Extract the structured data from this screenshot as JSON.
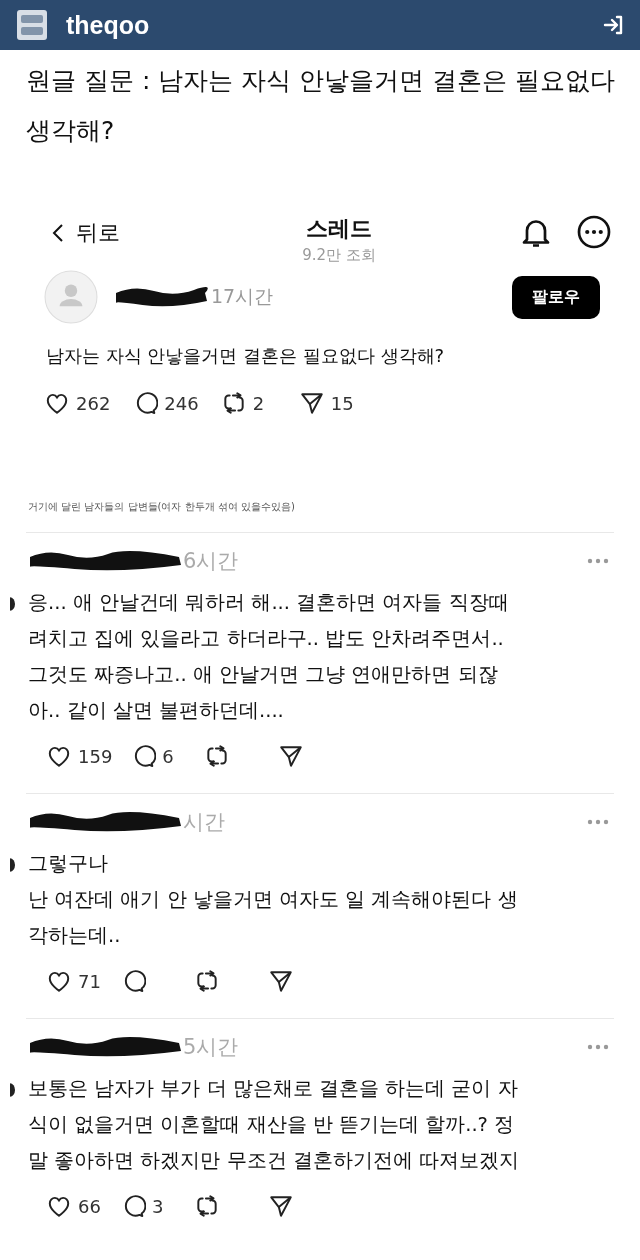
{
  "site_header": {
    "logo_text": "theqoo"
  },
  "post_title": "원글 질문 : 남자는 자식 안낳을거면 결혼은 필요없다 생각해?",
  "thread_header": {
    "back_label": "뒤로",
    "title": "스레드",
    "views": "9.2만 조회"
  },
  "original_post": {
    "time": "17시간",
    "follow_button": "팔로우",
    "text": "남자는 자식 안낳을거면 결혼은 필요없다 생각해?",
    "actions": [
      {
        "kind": "like",
        "count": "262"
      },
      {
        "kind": "reply",
        "count": "246"
      },
      {
        "kind": "repost",
        "count": "2"
      },
      {
        "kind": "share",
        "count": "15"
      }
    ]
  },
  "note": "거기에 달린 남자들의 답변들(여자 한두개 섞여 있을수있음)",
  "replies": [
    {
      "time": "6시간",
      "lines": [
        "응... 애 안날건데 뭐하러 해... 결혼하면 여자들 직장때",
        "려치고 집에 있을라고 하더라구.. 밥도 안차려주면서..",
        "그것도 짜증나고.. 애 안날거면 그냥 연애만하면 되잖",
        "아.. 같이 살면 불편하던데...."
      ],
      "actions": [
        {
          "kind": "like",
          "count": "159"
        },
        {
          "kind": "reply",
          "count": "6"
        },
        {
          "kind": "repost"
        },
        {
          "kind": "share"
        }
      ]
    },
    {
      "time": "시간",
      "lines": [
        "그렇구나",
        "난 여잔데 애기 안 낳을거면 여자도 일 계속해야된다 생",
        "각하는데.."
      ],
      "actions": [
        {
          "kind": "like",
          "count": "71"
        },
        {
          "kind": "reply"
        },
        {
          "kind": "repost"
        },
        {
          "kind": "share"
        }
      ]
    },
    {
      "time": "5시간",
      "lines": [
        "보통은 남자가 부가 더 많은채로 결혼을 하는데 굳이 자",
        "식이 없을거면 이혼할때 재산을 반 뜯기는데 할까..? 정",
        "말 좋아하면 하겠지만 무조건 결혼하기전에 따져보겠지"
      ],
      "actions": [
        {
          "kind": "like",
          "count": "66"
        },
        {
          "kind": "reply",
          "count": "3"
        },
        {
          "kind": "repost"
        },
        {
          "kind": "share"
        }
      ]
    }
  ]
}
